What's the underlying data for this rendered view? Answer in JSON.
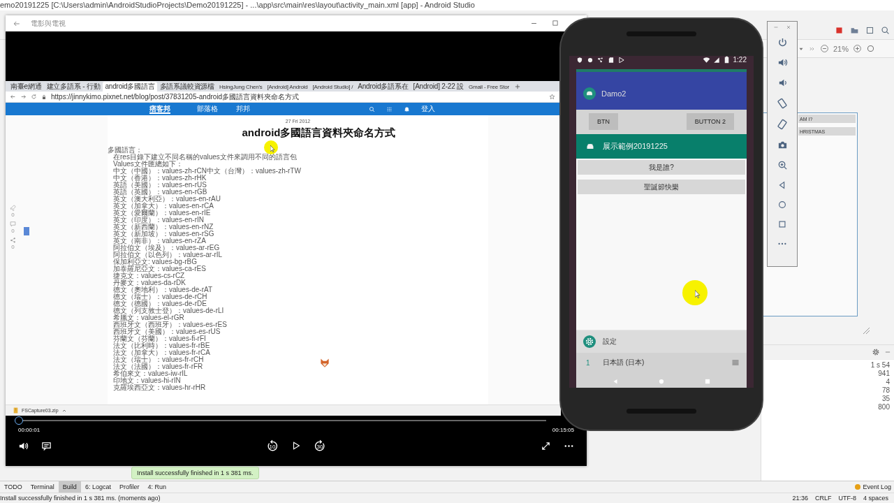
{
  "ide": {
    "title": "emo20191225 [C:\\Users\\admin\\AndroidStudioProjects\\Demo20191225] - ...\\app\\src\\main\\res\\layout\\activity_main.xml [app] - Android Studio",
    "zoom": "21%",
    "preview_buttons": [
      "AM I?",
      "HRISTMAS"
    ],
    "build_times": [
      "1 s 54",
      "941",
      "4",
      "78",
      "35",
      "800"
    ],
    "tool_tabs": [
      {
        "label": "TODO",
        "selected": false
      },
      {
        "label": "Terminal",
        "selected": false
      },
      {
        "label": "Build",
        "selected": true
      },
      {
        "label": "6: Logcat",
        "selected": false
      },
      {
        "label": "Profiler",
        "selected": false
      },
      {
        "label": "4: Run",
        "selected": false
      }
    ],
    "event_log": "Event Log",
    "status": "Install successfully finished in 1 s 381 ms. (moments ago)",
    "status_items": [
      "21:36",
      "CRLF",
      "UTF-8",
      "4 spaces"
    ],
    "balloon": "Install successfully finished in 1 s 381 ms."
  },
  "player": {
    "title": "電影與電視",
    "browser": {
      "tabs": [
        {
          "label": "南臺e網通",
          "selected": false
        },
        {
          "label": "建立多語系 - 行動",
          "selected": false
        },
        {
          "label": "android多國語言",
          "selected": true
        },
        {
          "label": "多語系議較資源檔",
          "selected": false
        },
        {
          "label": "HsingJung Chen's",
          "selected": false
        },
        {
          "label": "[Android] Android",
          "selected": false
        },
        {
          "label": "[Android Studio] /",
          "selected": false
        },
        {
          "label": "Android多語系在",
          "selected": false
        },
        {
          "label": "[Android] 2-22 設",
          "selected": false
        },
        {
          "label": "Gmail - Free Stor",
          "selected": false
        }
      ],
      "url": "https://jinnykimo.pixnet.net/blog/post/37831205-android多國語言資料夾命名方式",
      "site_logo": "痞客邦",
      "site_links": [
        "部落格",
        "邦邦"
      ],
      "login": "登入",
      "social_counts": [
        "0",
        "0",
        "0"
      ],
      "date": "27 Fri 2012",
      "article_title": "android多國語言資料夾命名方式",
      "lines": [
        "多國語言：",
        "在res目錄下建立不同名稱的values文件來調用不同的語言包",
        "Values文件匯總如下：",
        "中文（中國）：values-zh-rCN中文（台灣）：values-zh-rTW",
        "中文（香港）：values-zh-rHK",
        "英語（美國）：values-en-rUS",
        "英語（英國）：values-en-rGB",
        "英文（澳大利亞）：values-en-rAU",
        "英文（加拿大）：values-en-rCA",
        "英文（愛爾蘭）：values-en-rIE",
        "英文（印度）：values-en-rIN",
        "英文（新西蘭）：values-en-rNZ",
        "英文（新加坡）：values-en-rSG",
        "英文（南非）：values-en-rZA",
        "阿拉伯文（埃及）：values-ar-rEG",
        "阿拉伯文（以色列）：values-ar-rIL",
        "保加利亞文: values-bg-rBG",
        "加泰羅尼亞文：values-ca-rES",
        "捷克文：values-cs-rCZ",
        "丹麥文：values-da-rDK",
        "德文（奧地利）：values-de-rAT",
        "德文（瑞士）：values-de-rCH",
        "德文（德國）：values-de-rDE",
        "德文（列支敦士登）：values-de-rLI",
        "希臘文：values-el-rGR",
        "西班牙文（西班牙）：values-es-rES",
        "西班牙文（美國）：values-es-rUS",
        "芬蘭文（芬蘭）：values-fi-rFI",
        "法文（比利時）：values-fr-rBE",
        "法文（加拿大）：values-fr-rCA",
        "法文（瑞士）：values-fr-rCH",
        "法文（法國）：values-fr-rFR",
        "希伯來文：values-iw-rIL",
        "印地文：values-hi-rIN",
        "克羅埃西亞文：values-hr-rHR"
      ],
      "download": "FSCapture03.zip"
    },
    "progress": {
      "level": 0.001
    },
    "elapsed": "00:00:01",
    "duration": "00:15:05",
    "skip_back": "10",
    "skip_forward": "30"
  },
  "phone": {
    "clock": "1:22",
    "back_card": {
      "title": "Damo2",
      "buttons": [
        "BTN",
        "BUTTON 2"
      ]
    },
    "front_card": {
      "title": "展示範例20191225",
      "buttons": [
        "我是誰?",
        "聖誕節快樂"
      ]
    },
    "settings_card": {
      "title": "設定",
      "row_number": "1",
      "row_label": "日本語 (日本)"
    }
  }
}
